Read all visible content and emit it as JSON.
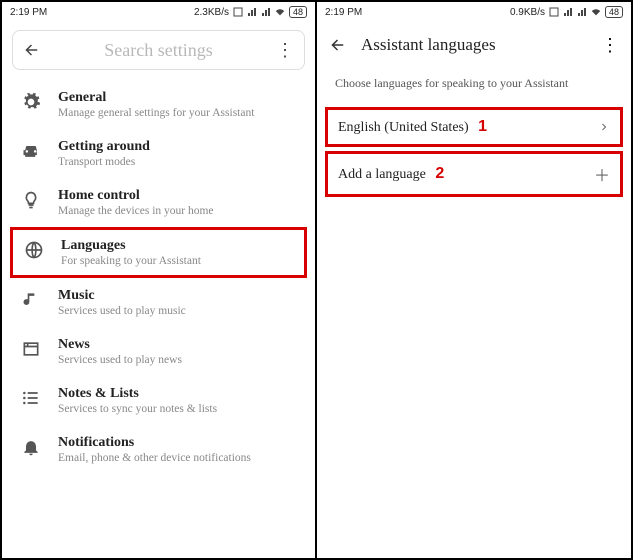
{
  "status": {
    "time": "2:19 PM",
    "net_left": "2.3KB/s",
    "net_right": "0.9KB/s",
    "battery": "48"
  },
  "left": {
    "search_placeholder": "Search settings",
    "items": [
      {
        "title": "General",
        "sub": "Manage general settings for your Assistant"
      },
      {
        "title": "Getting around",
        "sub": "Transport modes"
      },
      {
        "title": "Home control",
        "sub": "Manage the devices in your home"
      },
      {
        "title": "Languages",
        "sub": "For speaking to your Assistant"
      },
      {
        "title": "Music",
        "sub": "Services used to play music"
      },
      {
        "title": "News",
        "sub": "Services used to play news"
      },
      {
        "title": "Notes & Lists",
        "sub": "Services to sync your notes & lists"
      },
      {
        "title": "Notifications",
        "sub": "Email, phone & other device notifications"
      }
    ]
  },
  "right": {
    "title": "Assistant languages",
    "subtitle": "Choose languages for speaking to your Assistant",
    "rows": [
      {
        "label": "English (United States)",
        "annot": "1"
      },
      {
        "label": "Add a language",
        "annot": "2"
      }
    ]
  }
}
